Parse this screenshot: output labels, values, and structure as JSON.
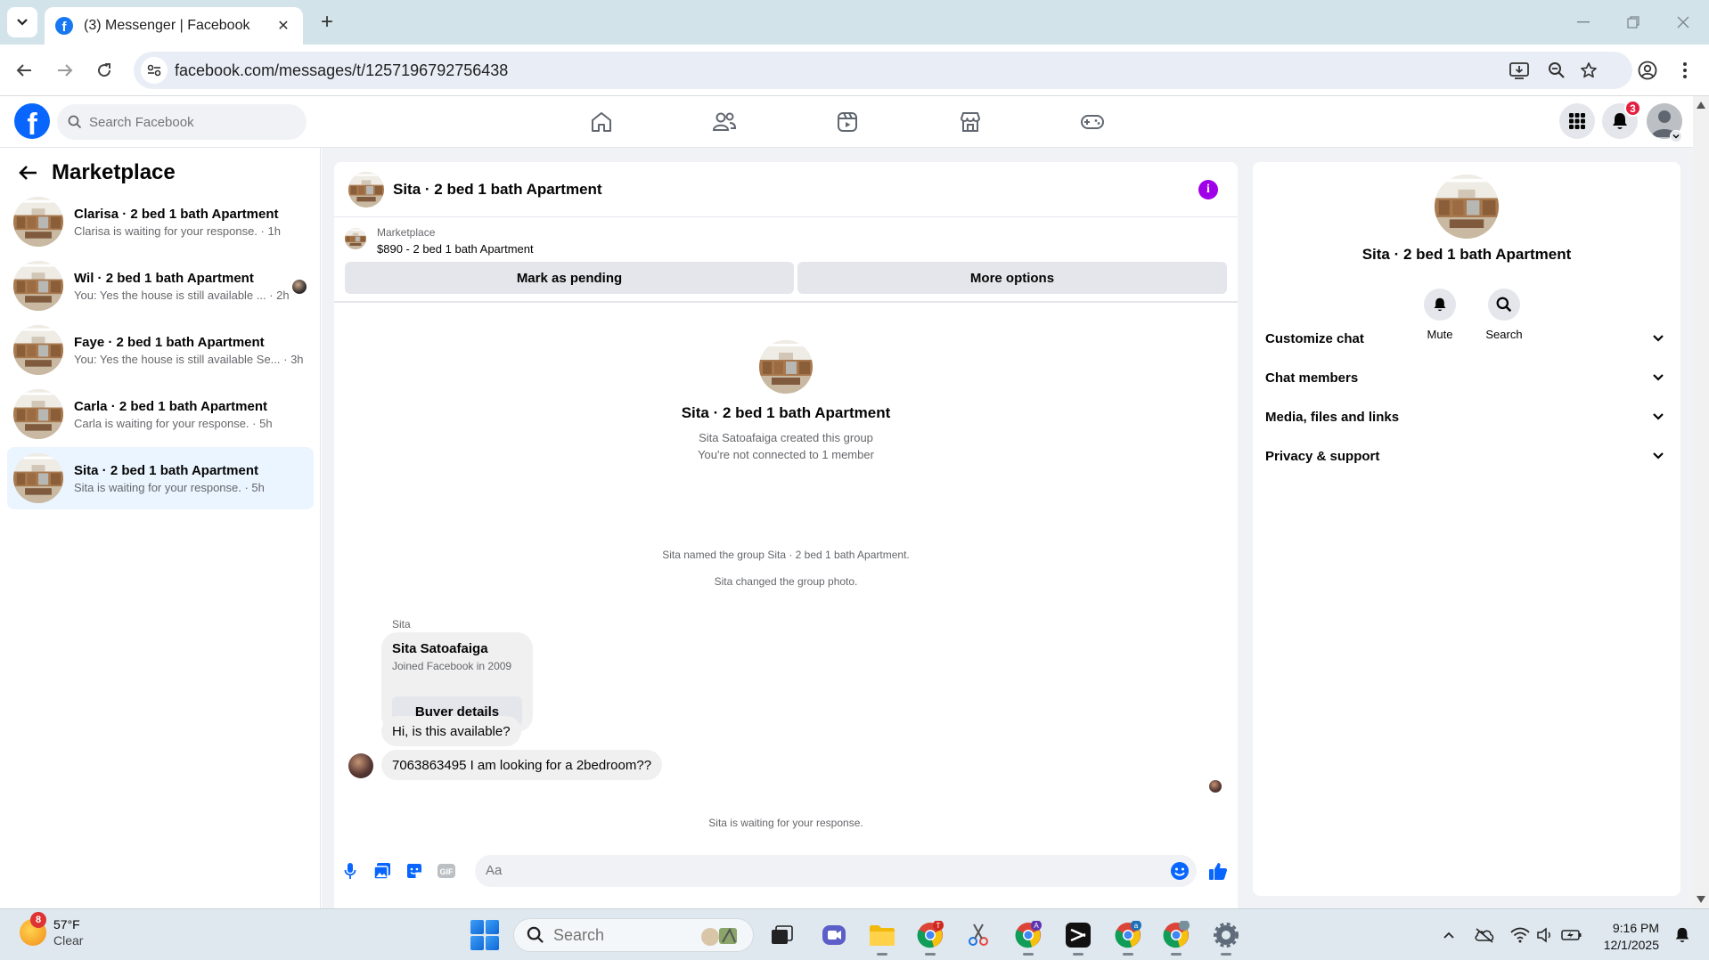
{
  "browser": {
    "tab_title": "(3) Messenger | Facebook",
    "url": "facebook.com/messages/t/1257196792756438"
  },
  "fb": {
    "search_placeholder": "Search Facebook",
    "notification_count": "3",
    "brand_color": "#0866ff"
  },
  "sidebar": {
    "title": "Marketplace",
    "conversations": [
      {
        "name": "Clarisa · 2 bed 1 bath Apartment",
        "preview": "Clarisa is waiting for your response. · 1h"
      },
      {
        "name": "Wil · 2 bed 1 bath Apartment",
        "preview": "You: Yes the house is still available ... · 2h"
      },
      {
        "name": "Faye · 2 bed 1 bath Apartment",
        "preview": "You: Yes the house is still available Se... · 3h"
      },
      {
        "name": "Carla · 2 bed 1 bath Apartment",
        "preview": "Carla is waiting for your response. · 5h"
      },
      {
        "name": "Sita · 2 bed 1 bath Apartment",
        "preview": "Sita is waiting for your response. · 5h"
      }
    ]
  },
  "chat": {
    "title": "Sita · 2 bed 1 bath Apartment",
    "listing_label": "Marketplace",
    "listing_price": "$890 - 2 bed 1 bath Apartment",
    "mark_pending": "Mark as pending",
    "more_options": "More options",
    "intro_name": "Sita · 2 bed 1 bath Apartment",
    "intro_created": "Sita Satoafaiga created this group",
    "intro_connected": "You're not connected to 1 member",
    "sys_named": "Sita named the group Sita · 2 bed 1 bath Apartment.",
    "sys_photo": "Sita changed the group photo.",
    "sender": "Sita",
    "card_name": "Sita Satoafaiga",
    "card_joined": "Joined Facebook in 2009",
    "card_button": "Buyer details",
    "msg1": "Hi, is this available?",
    "msg2": "7063863495 I am looking for a 2bedroom??",
    "waiting": "Sita is waiting for your response.",
    "composer_placeholder": "Aa",
    "gif_label": "GIF"
  },
  "info": {
    "name": "Sita · 2 bed 1 bath Apartment",
    "mute": "Mute",
    "search": "Search",
    "sections": [
      "Customize chat",
      "Chat members",
      "Media, files and links",
      "Privacy & support"
    ]
  },
  "taskbar": {
    "weather_badge": "8",
    "temp": "57°F",
    "condition": "Clear",
    "search_placeholder": "Search",
    "time": "9:16 PM",
    "date": "12/1/2025"
  }
}
